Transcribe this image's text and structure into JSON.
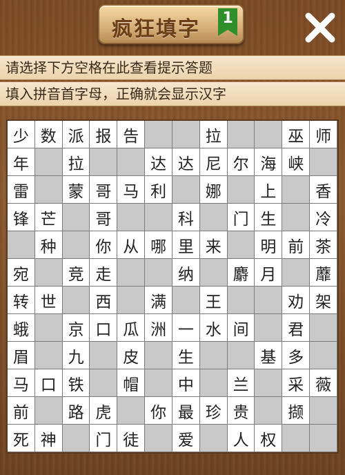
{
  "header": {
    "title": "疯狂填字",
    "level": "1",
    "close_icon": "close-icon"
  },
  "hints": [
    "请选择下方空格在此查看提示答题",
    "填入拼音首字母，正确就会显示汉字"
  ],
  "colors": {
    "wood": "#7a4a24",
    "hint_bg": "#f1dcbc",
    "filled_cell": "#ffffff",
    "empty_cell": "#c8c8c8",
    "badge": "#2f8f2a"
  },
  "grid": [
    [
      "少",
      "数",
      "派",
      "报",
      "告",
      "",
      "",
      "拉",
      "",
      "",
      "巫",
      "师"
    ],
    [
      "年",
      "",
      "拉",
      "",
      "",
      "达",
      "达",
      "尼",
      "尔",
      "海",
      "峡",
      ""
    ],
    [
      "雷",
      "",
      "蒙",
      "哥",
      "马",
      "利",
      "",
      "娜",
      "",
      "上",
      "",
      "香"
    ],
    [
      "锋",
      "芒",
      "",
      "哥",
      "",
      "",
      "科",
      "",
      "门",
      "生",
      "",
      "冷"
    ],
    [
      "",
      "种",
      "",
      "你",
      "从",
      "哪",
      "里",
      "来",
      "",
      "明",
      "前",
      "茶"
    ],
    [
      "宛",
      "",
      "竞",
      "走",
      "",
      "",
      "纳",
      "",
      "麝",
      "月",
      "",
      "蘼"
    ],
    [
      "转",
      "世",
      "",
      "西",
      "",
      "满",
      "",
      "王",
      "",
      "",
      "劝",
      "架"
    ],
    [
      "蛾",
      "",
      "京",
      "口",
      "瓜",
      "洲",
      "一",
      "水",
      "间",
      "",
      "君",
      ""
    ],
    [
      "眉",
      "",
      "九",
      "",
      "皮",
      "",
      "生",
      "",
      "",
      "基",
      "多",
      ""
    ],
    [
      "马",
      "口",
      "铁",
      "",
      "帽",
      "",
      "中",
      "",
      "兰",
      "",
      "采",
      "薇"
    ],
    [
      "前",
      "",
      "路",
      "虎",
      "",
      "你",
      "最",
      "珍",
      "贵",
      "",
      "撷",
      ""
    ],
    [
      "死",
      "神",
      "",
      "门",
      "徒",
      "",
      "爱",
      "",
      "人",
      "权",
      "",
      ""
    ]
  ]
}
